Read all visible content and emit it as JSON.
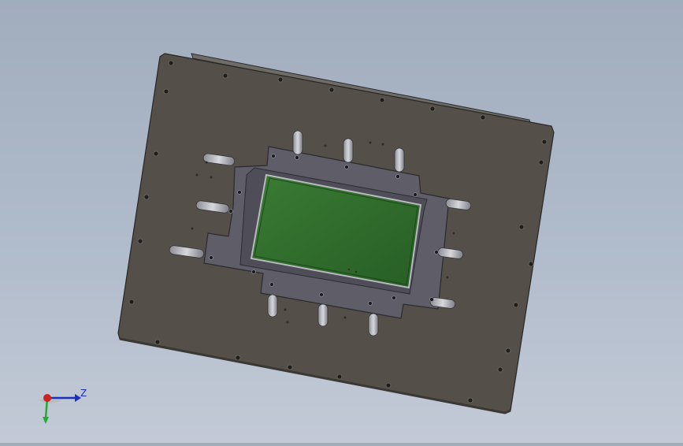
{
  "viewport": {
    "background_top": "#a1acbd",
    "background_bottom": "#c3cad6"
  },
  "model": {
    "plate_color": "#545049",
    "carrier_color": "#5a5a66",
    "board_color": "#2d6a2a",
    "slot_color": "#e6e6ea",
    "screw_color": "#1c1c1c"
  },
  "triad": {
    "z_label": "Z",
    "x_axis_color": "#cc2222",
    "y_axis_color": "#22aa33",
    "z_axis_color": "#1a2fbd"
  }
}
